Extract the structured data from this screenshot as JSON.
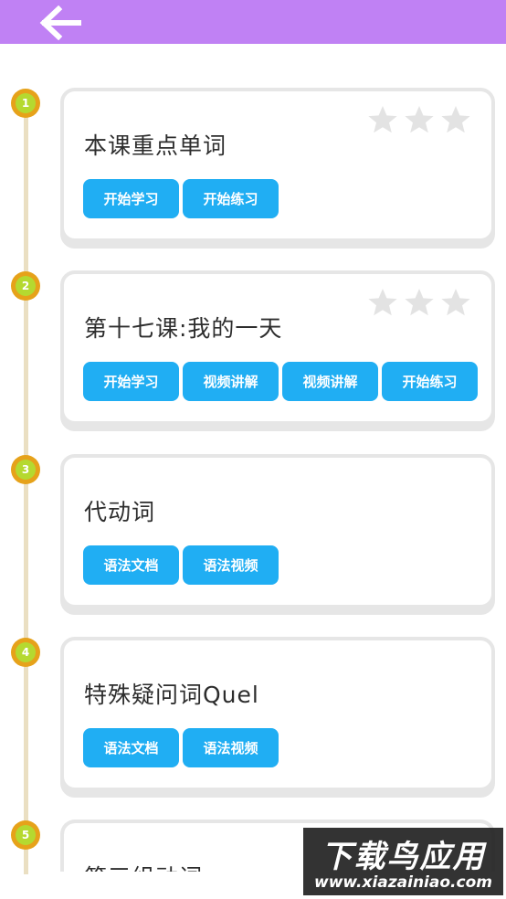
{
  "header": {
    "back_icon": "arrow-left-icon",
    "background_color": "#c081f4"
  },
  "lessons": [
    {
      "number": "1",
      "title": "本课重点单词",
      "stars_earned": 0,
      "stars_total": 3,
      "buttons": [
        "开始学习",
        "开始练习"
      ]
    },
    {
      "number": "2",
      "title": "第十七课:我的一天",
      "stars_earned": 0,
      "stars_total": 3,
      "buttons": [
        "开始学习",
        "视频讲解",
        "视频讲解",
        "开始练习"
      ]
    },
    {
      "number": "3",
      "title": "代动词",
      "buttons": [
        "语法文档",
        "语法视频"
      ]
    },
    {
      "number": "4",
      "title": "特殊疑问词Quel",
      "buttons": [
        "语法文档",
        "语法视频"
      ]
    },
    {
      "number": "5",
      "title": "第三组动词",
      "buttons": []
    }
  ],
  "colors": {
    "button": "#20aef3",
    "timeline": "#eadfc2",
    "node_outer": "#e6a21a",
    "node_inner": "#b5d930",
    "star": "#e3e3e3"
  },
  "watermark": {
    "logo": "下载鸟应用",
    "url": "www.xiazainiao.com"
  }
}
